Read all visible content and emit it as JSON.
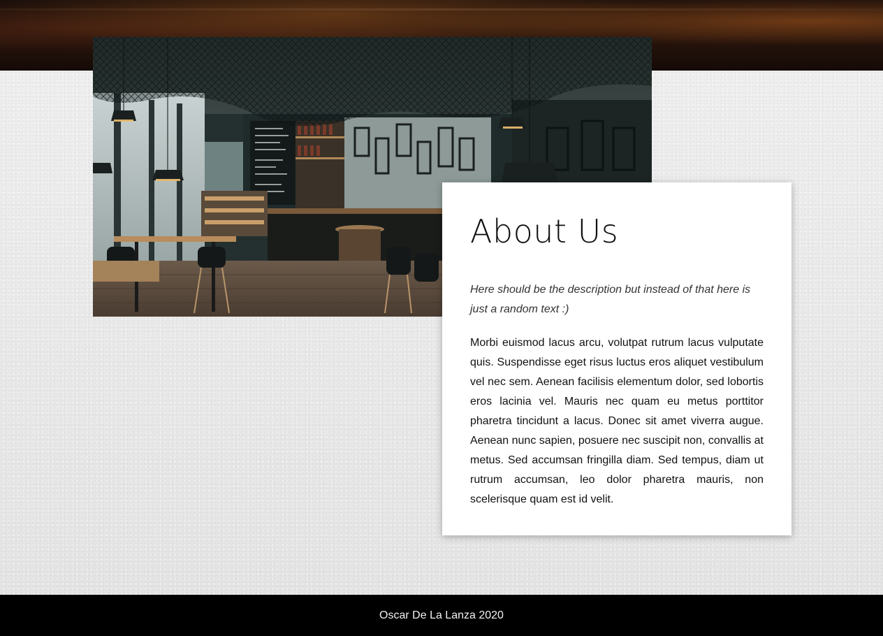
{
  "header": {
    "banner_image": "cafe-ceiling-banner"
  },
  "photo": {
    "subject": "cafe-interior-photo"
  },
  "about": {
    "title": "About Us",
    "subtitle": "Here should be the description but instead of that here is just a random text :)",
    "body": "Morbi euismod lacus arcu, volutpat rutrum lacus vulputate quis. Suspendisse eget risus luctus eros aliquet vestibulum vel nec sem. Aenean facilisis elementum dolor, sed lobortis eros lacinia vel. Mauris nec quam eu metus porttitor pharetra tincidunt a lacus. Donec sit amet viverra augue. Aenean nunc sapien, posuere nec suscipit non, convallis at metus. Sed accumsan fringilla diam. Sed tempus, diam ut rutrum accumsan, leo dolor pharetra mauris, non scelerisque quam est id velit."
  },
  "footer": {
    "text": "Oscar De La Lanza 2020"
  },
  "colors": {
    "footer_bg": "#000000",
    "card_bg": "#ffffff",
    "page_bg": "#e9e9e9"
  }
}
